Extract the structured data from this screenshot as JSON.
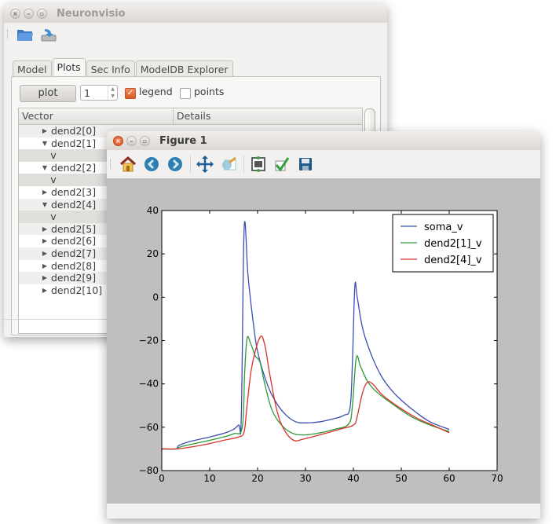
{
  "main_window": {
    "title": "Neuronvisio",
    "toolbar": [
      {
        "icon": "folder-open-icon"
      },
      {
        "icon": "load-icon"
      }
    ],
    "tabs": [
      {
        "label": "Model",
        "active": false
      },
      {
        "label": "Plots",
        "active": true
      },
      {
        "label": "Sec Info",
        "active": false
      },
      {
        "label": "ModelDB Explorer",
        "active": false
      }
    ],
    "plots_panel": {
      "plot_button": "plot",
      "spinbox_value": "1",
      "legend_label": "legend",
      "legend_checked": true,
      "points_label": "points",
      "points_checked": false,
      "columns": [
        "Vector",
        "Details"
      ],
      "rows": [
        {
          "label": "dend2[0]",
          "expanded": false
        },
        {
          "label": "dend2[1]",
          "expanded": true
        },
        {
          "label": "v",
          "child": true
        },
        {
          "label": "dend2[2]",
          "expanded": true
        },
        {
          "label": "v",
          "child": true
        },
        {
          "label": "dend2[3]",
          "expanded": false
        },
        {
          "label": "dend2[4]",
          "expanded": true
        },
        {
          "label": "v",
          "child": true
        },
        {
          "label": "dend2[5]",
          "expanded": false
        },
        {
          "label": "dend2[6]",
          "expanded": false
        },
        {
          "label": "dend2[7]",
          "expanded": false
        },
        {
          "label": "dend2[8]",
          "expanded": false
        },
        {
          "label": "dend2[9]",
          "expanded": false
        },
        {
          "label": "dend2[10]",
          "expanded": false
        }
      ]
    }
  },
  "figure_window": {
    "title": "Figure 1",
    "toolbar": [
      "home-icon",
      "back-icon",
      "forward-icon",
      "pan-icon",
      "zoom-rect-icon",
      "subplots-icon",
      "edit-check-icon",
      "save-icon"
    ]
  },
  "chart_data": {
    "type": "line",
    "title": "",
    "xlabel": "",
    "ylabel": "",
    "xlim": [
      0,
      70
    ],
    "ylim": [
      -80,
      40
    ],
    "xticks": [
      0,
      10,
      20,
      30,
      40,
      50,
      60,
      70
    ],
    "yticks": [
      -80,
      -60,
      -40,
      -20,
      0,
      20,
      40
    ],
    "grid": false,
    "legend": "top-right",
    "series": [
      {
        "name": "soma_v",
        "color": "#3b4fb0",
        "points": [
          [
            0,
            -70
          ],
          [
            3,
            -70
          ],
          [
            3.5,
            -68.5
          ],
          [
            6,
            -66.5
          ],
          [
            10,
            -64.5
          ],
          [
            14,
            -62
          ],
          [
            16,
            -59
          ],
          [
            16.6,
            -55
          ],
          [
            17.2,
            32
          ],
          [
            18,
            10
          ],
          [
            19,
            -10
          ],
          [
            20,
            -25
          ],
          [
            22,
            -40
          ],
          [
            24,
            -49
          ],
          [
            26,
            -54.5
          ],
          [
            28,
            -57.5
          ],
          [
            30,
            -58
          ],
          [
            33,
            -57.5
          ],
          [
            36,
            -56
          ],
          [
            38,
            -54.5
          ],
          [
            39.3,
            -51
          ],
          [
            39.8,
            -30
          ],
          [
            40.3,
            5
          ],
          [
            40.8,
            0
          ],
          [
            42,
            -15
          ],
          [
            44,
            -28
          ],
          [
            46,
            -37
          ],
          [
            48,
            -43
          ],
          [
            50,
            -47.5
          ],
          [
            53,
            -53
          ],
          [
            56,
            -57.5
          ],
          [
            60,
            -61
          ]
        ]
      },
      {
        "name": "dend2[1]_v",
        "color": "#2e9a3a",
        "points": [
          [
            0,
            -70
          ],
          [
            3,
            -70
          ],
          [
            4,
            -69
          ],
          [
            8,
            -67
          ],
          [
            12,
            -65
          ],
          [
            15,
            -63
          ],
          [
            16.8,
            -60
          ],
          [
            17.3,
            -35
          ],
          [
            17.8,
            -19
          ],
          [
            18.5,
            -21
          ],
          [
            19.5,
            -27
          ],
          [
            20.5,
            -30
          ],
          [
            21.5,
            -40
          ],
          [
            23,
            -52
          ],
          [
            25,
            -59
          ],
          [
            27,
            -62.5
          ],
          [
            29,
            -63.5
          ],
          [
            32,
            -63
          ],
          [
            36,
            -61
          ],
          [
            39,
            -58.5
          ],
          [
            39.8,
            -50
          ],
          [
            40.6,
            -28
          ],
          [
            41.5,
            -32
          ],
          [
            43,
            -39
          ],
          [
            45,
            -44
          ],
          [
            48,
            -49
          ],
          [
            52,
            -55
          ],
          [
            56,
            -59
          ],
          [
            60,
            -62
          ]
        ]
      },
      {
        "name": "dend2[4]_v",
        "color": "#d8312a",
        "points": [
          [
            0,
            -70
          ],
          [
            3,
            -70
          ],
          [
            5,
            -69.5
          ],
          [
            9,
            -68
          ],
          [
            13,
            -66
          ],
          [
            16,
            -64.5
          ],
          [
            17.2,
            -62
          ],
          [
            17.8,
            -50
          ],
          [
            18.8,
            -32
          ],
          [
            20.5,
            -18.5
          ],
          [
            21.5,
            -22
          ],
          [
            22.5,
            -35
          ],
          [
            24,
            -52
          ],
          [
            25.5,
            -61
          ],
          [
            27.5,
            -66
          ],
          [
            29.5,
            -65.5
          ],
          [
            33,
            -63.5
          ],
          [
            37,
            -61
          ],
          [
            40,
            -59
          ],
          [
            40.8,
            -55
          ],
          [
            41.8,
            -45
          ],
          [
            42.8,
            -39.5
          ],
          [
            44,
            -40
          ],
          [
            46,
            -45
          ],
          [
            49,
            -50
          ],
          [
            53,
            -55.5
          ],
          [
            57,
            -59.5
          ],
          [
            60,
            -62.5
          ]
        ]
      }
    ]
  }
}
